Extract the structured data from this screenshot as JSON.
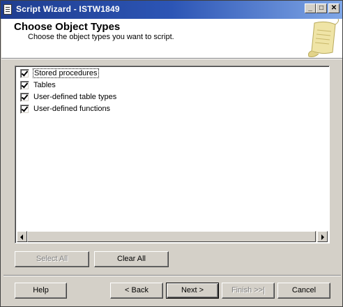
{
  "window": {
    "title": "Script Wizard - ISTW1849",
    "controls": {
      "minimize": "_",
      "maximize": "□",
      "close": "✕"
    }
  },
  "header": {
    "title": "Choose Object Types",
    "subtitle": "Choose the object types you want to script."
  },
  "object_types": [
    {
      "label": "Stored procedures",
      "checked": true
    },
    {
      "label": "Tables",
      "checked": true
    },
    {
      "label": "User-defined table types",
      "checked": true
    },
    {
      "label": "User-defined functions",
      "checked": true
    }
  ],
  "selection_buttons": {
    "select_all": "Select All",
    "clear_all": "Clear All"
  },
  "footer_buttons": {
    "help": "Help",
    "back": "< Back",
    "next": "Next >",
    "finish": "Finish >>|",
    "cancel": "Cancel"
  },
  "colors": {
    "title_bar_start": "#1f3d8f",
    "title_bar_end": "#7fa6e6",
    "dialog_face": "#d4d0c8",
    "disabled_text": "#808080"
  },
  "icons": {
    "window_icon": "script-document-icon",
    "header_art": "scroll-parchment-icon"
  }
}
